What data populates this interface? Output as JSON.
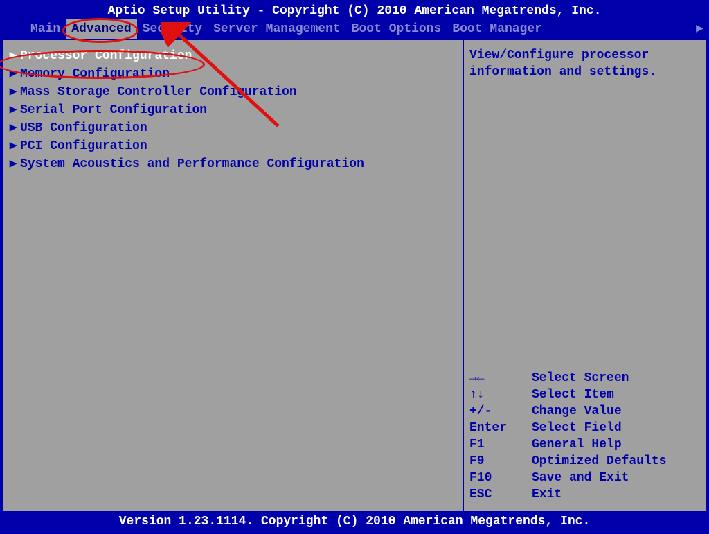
{
  "header": {
    "title": "Aptio Setup Utility - Copyright (C) 2010 American Megatrends, Inc.",
    "tabs": [
      {
        "label": "Main",
        "selected": false
      },
      {
        "label": "Advanced",
        "selected": true
      },
      {
        "label": "Security",
        "selected": false
      },
      {
        "label": "Server Management",
        "selected": false
      },
      {
        "label": "Boot Options",
        "selected": false
      },
      {
        "label": "Boot Manager",
        "selected": false
      }
    ]
  },
  "menu": {
    "items": [
      {
        "label": "Processor Configuration",
        "selected": true
      },
      {
        "label": "Memory Configuration",
        "selected": false
      },
      {
        "label": "Mass Storage Controller Configuration",
        "selected": false
      },
      {
        "label": "Serial Port Configuration",
        "selected": false
      },
      {
        "label": "USB Configuration",
        "selected": false
      },
      {
        "label": "PCI Configuration",
        "selected": false
      },
      {
        "label": "System Acoustics and Performance Configuration",
        "selected": false
      }
    ]
  },
  "help": {
    "text": "View/Configure processor information and settings.",
    "keys": [
      {
        "key": "→←",
        "desc": "Select Screen"
      },
      {
        "key": "↑↓",
        "desc": "Select Item"
      },
      {
        "key": "+/-",
        "desc": "Change Value"
      },
      {
        "key": "Enter",
        "desc": "Select Field"
      },
      {
        "key": "F1",
        "desc": "General Help"
      },
      {
        "key": "F9",
        "desc": "Optimized Defaults"
      },
      {
        "key": "F10",
        "desc": "Save and Exit"
      },
      {
        "key": "ESC",
        "desc": "Exit"
      }
    ]
  },
  "footer": {
    "text": "Version 1.23.1114. Copyright (C) 2010 American Megatrends, Inc."
  }
}
